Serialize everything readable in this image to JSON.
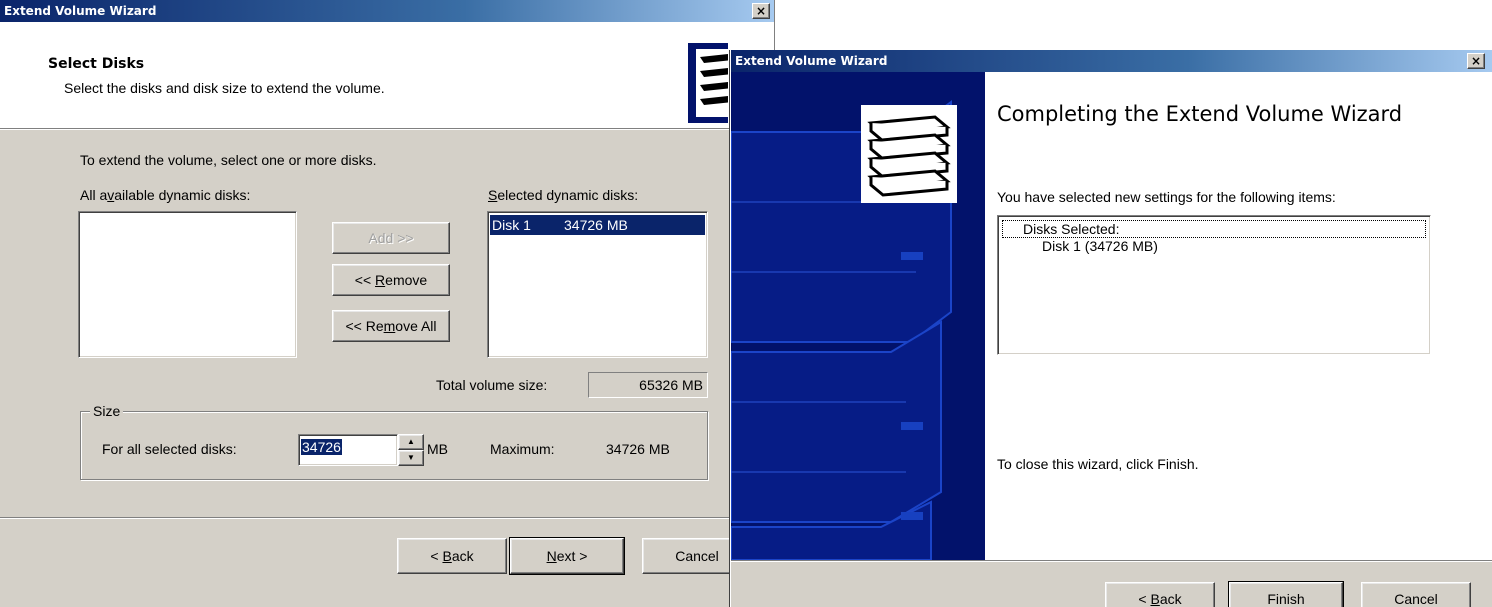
{
  "left": {
    "title": "Extend Volume Wizard",
    "close": "×",
    "header_title": "Select Disks",
    "header_subtitle": "Select the disks and disk size to extend the volume.",
    "instruction": "To extend the volume, select one or more disks.",
    "available_label_pre": "All a",
    "available_label_acc": "v",
    "available_label_post": "ailable dynamic disks:",
    "selected_label_acc": "S",
    "selected_label_post": "elected dynamic disks:",
    "add_label": "Add >>",
    "remove_label_pre": "<< ",
    "remove_label_acc": "R",
    "remove_label_post": "emove",
    "remove_all_pre": "<< Re",
    "remove_all_acc": "m",
    "remove_all_post": "ove All",
    "selected_items": [
      {
        "disk": "Disk 1",
        "size": "34726 MB"
      }
    ],
    "total_label": "Total volume size:",
    "total_value": "65326 MB",
    "size_group_label": "Size",
    "for_all_label": "For all selected disks:",
    "size_value": "34726",
    "size_unit": "MB",
    "maximum_label": "Maximum:",
    "maximum_value": "34726 MB",
    "back_pre": "< ",
    "back_acc": "B",
    "back_post": "ack",
    "next_acc": "N",
    "next_post": "ext >",
    "cancel_label": "Cancel"
  },
  "right": {
    "title": "Extend Volume Wizard",
    "close": "×",
    "heading": "Completing the Extend Volume Wizard",
    "settings_text": "You have selected new settings for the following items:",
    "summary_header": "Disks Selected:",
    "summary_item": "Disk 1 (34726 MB)",
    "close_text": "To close this wizard, click Finish.",
    "back_pre": "< ",
    "back_acc": "B",
    "back_post": "ack",
    "finish_label": "Finish",
    "cancel_label": "Cancel"
  },
  "colors": {
    "title_active": "#0a246a",
    "selection": "#0a246a",
    "banner_dark": "#02126b"
  },
  "icons": {
    "wizard": "stacked-disks-icon",
    "spinner": "up-down-arrows"
  }
}
